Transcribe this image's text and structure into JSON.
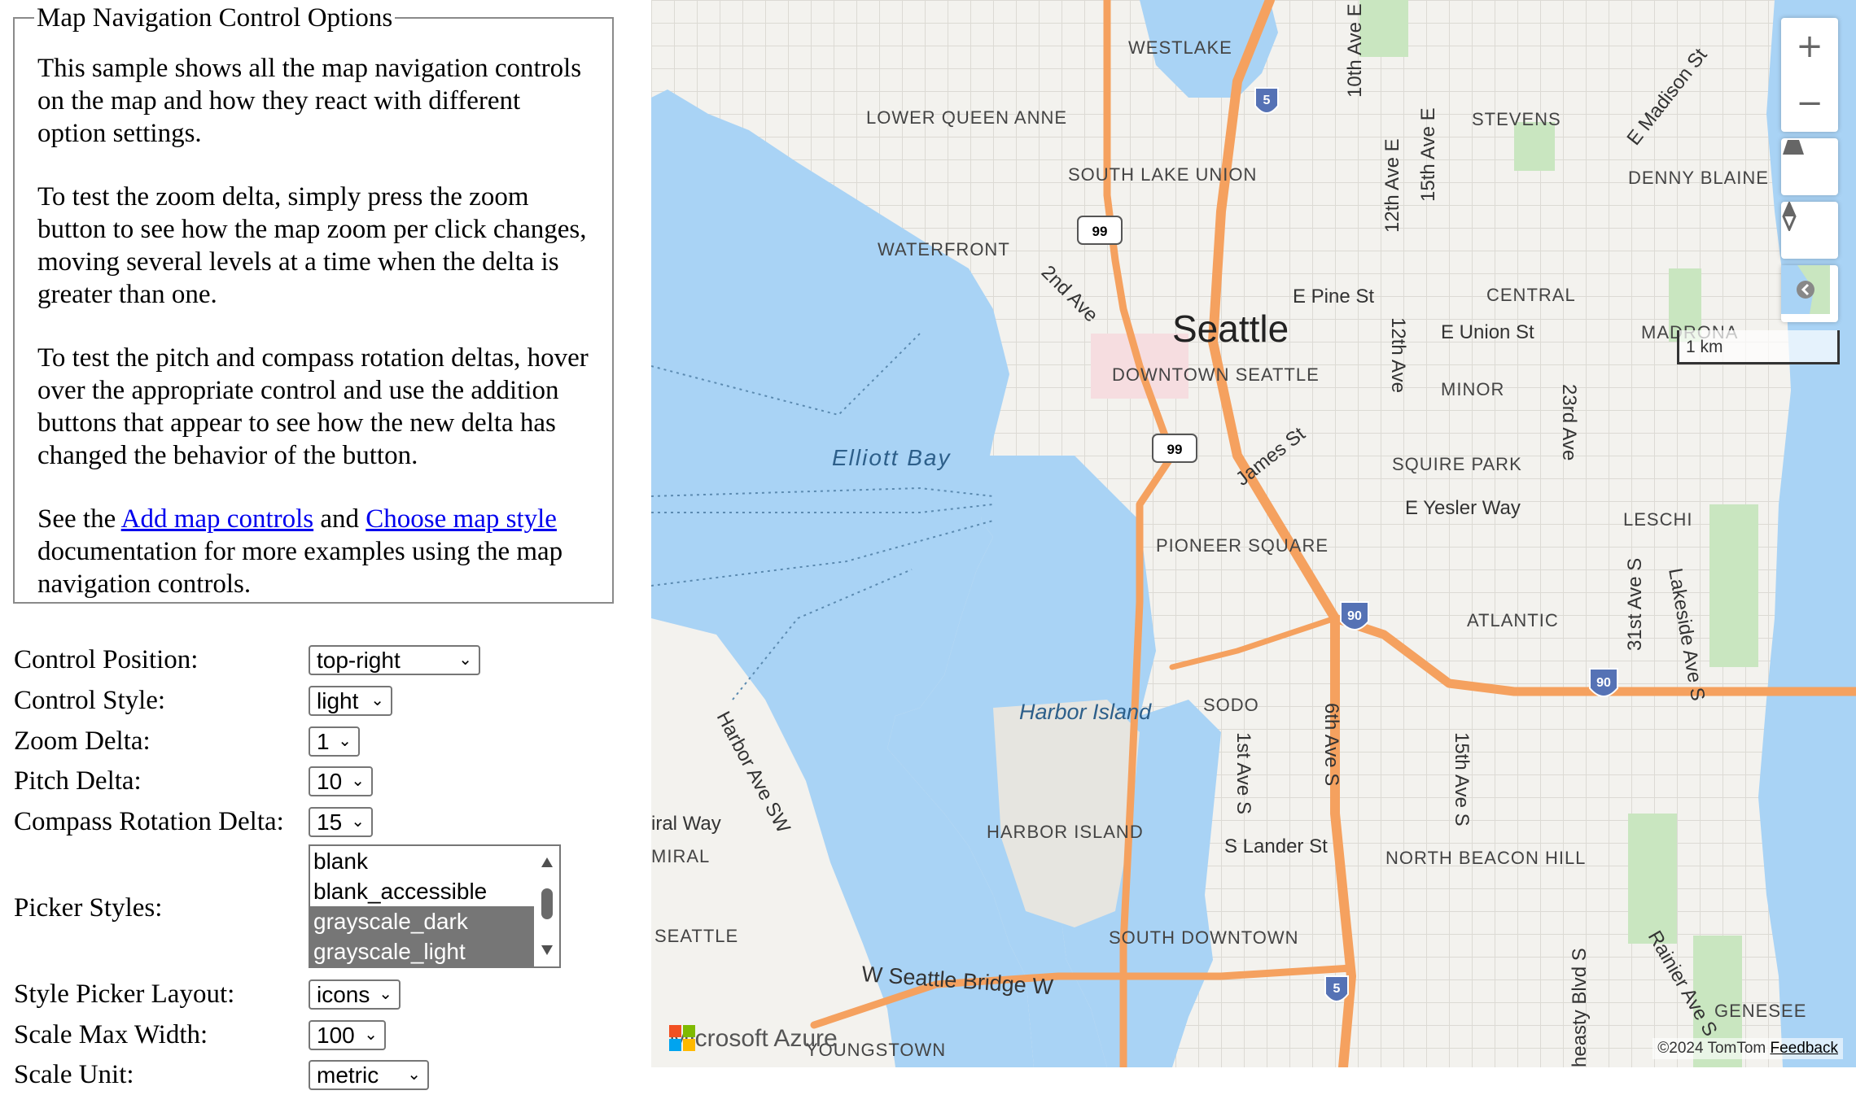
{
  "panel": {
    "legend": "Map Navigation Control Options",
    "p1": "This sample shows all the map navigation controls on the map and how they react with different option settings.",
    "p2": "To test the zoom delta, simply press the zoom button to see how the map zoom per click changes, moving several levels at a time when the delta is greater than one.",
    "p3": "To test the pitch and compass rotation deltas, hover over the appropriate control and use the addition buttons that appear to see how the new delta has changed the behavior of the button.",
    "p4_pre": "See the",
    "link1": "Add map controls",
    "p4_mid": "and",
    "link2": "Choose map style",
    "p4_post": "documentation for more examples using the map navigation controls."
  },
  "options": {
    "control_position": {
      "label": "Control Position:",
      "value": "top-right"
    },
    "control_style": {
      "label": "Control Style:",
      "value": "light"
    },
    "zoom_delta": {
      "label": "Zoom Delta:",
      "value": "1"
    },
    "pitch_delta": {
      "label": "Pitch Delta:",
      "value": "10"
    },
    "compass_delta": {
      "label": "Compass Rotation Delta:",
      "value": "15"
    },
    "picker_styles": {
      "label": "Picker Styles:",
      "items": [
        "blank",
        "blank_accessible",
        "grayscale_dark",
        "grayscale_light"
      ],
      "selected": [
        false,
        false,
        true,
        true
      ]
    },
    "style_picker_layout": {
      "label": "Style Picker Layout:",
      "value": "icons"
    },
    "scale_max_width": {
      "label": "Scale Max Width:",
      "value": "100"
    },
    "scale_unit": {
      "label": "Scale Unit:",
      "value": "metric"
    }
  },
  "map": {
    "city_label": "Seattle",
    "scale_label": "1 km",
    "attribution": "©2024 TomTom",
    "feedback": "Feedback",
    "logo_text": "Microsoft Azure",
    "water_color": "#a9d3f5",
    "land_color": "#f3f2ee",
    "highway_color": "#f5a15f",
    "park_color": "#c9e6c0",
    "controls": [
      "zoom-in-icon",
      "zoom-out-icon",
      "pitch-icon",
      "compass-icon",
      "style-picker-icon"
    ],
    "labels": {
      "westlake": "WESTLAKE",
      "lower_queen_anne": "LOWER QUEEN ANNE",
      "stevens": "STEVENS",
      "south_lake_union": "SOUTH LAKE UNION",
      "denny_blaine": "DENNY BLAINE",
      "waterfront": "WATERFRONT",
      "central": "CENTRAL",
      "madrona": "MADRONA",
      "downtown": "DOWNTOWN SEATTLE",
      "minor": "MINOR",
      "elliott_bay": "Elliott Bay",
      "squire_park": "SQUIRE PARK",
      "leschi": "LESCHI",
      "pioneer_square": "PIONEER SQUARE",
      "atlantic": "ATLANTIC",
      "sodo": "SODO",
      "harbor_island_water": "Harbor Island",
      "harbor_island": "HARBOR ISLAND",
      "north_beacon_hill": "NORTH BEACON HILL",
      "seattle_w": "SEATTLE",
      "south_downtown": "SOUTH DOWNTOWN",
      "genesee": "GENESEE",
      "youngstown": "YOUNGSTOWN",
      "miral": "MIRAL",
      "iral_way": "iral Way",
      "e_pine": "E Pine St",
      "e_union": "E Union St",
      "e_yesler": "E Yesler Way",
      "james": "James St",
      "s_lander": "S Lander St",
      "w_seattle_bridge": "W Seattle Bridge W",
      "second_ave": "2nd Ave",
      "tenth_ave": "10th Ave E",
      "twelfth_ave_e": "12th Ave E",
      "fifteenth_ave_e": "15th Ave E",
      "twelfth_ave": "12th Ave",
      "twentythird": "23rd Ave",
      "madison": "E Madison St",
      "thirtyfirst": "31st Ave S",
      "lakeside": "Lakeside Ave S",
      "first_ave_s": "1st Ave S",
      "sixth_ave_s": "6th Ave S",
      "fifteenth_ave_s": "15th Ave S",
      "harbor_ave": "Harbor Ave SW",
      "rainier": "Rainier Ave S",
      "beacon": "heasty Blvd S",
      "i5": "5",
      "i90": "90",
      "sr99": "99"
    }
  }
}
